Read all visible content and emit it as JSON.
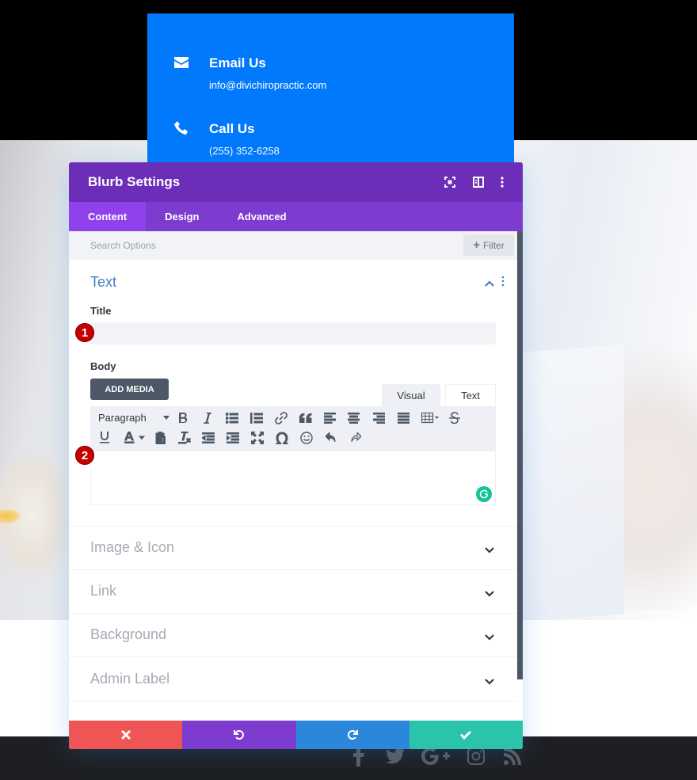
{
  "contact_card": {
    "items": [
      {
        "icon": "envelope-icon",
        "title": "Email Us",
        "text": "info@divichiropractic.com"
      },
      {
        "icon": "phone-icon",
        "title": "Call Us",
        "text": "(255) 352-6258"
      }
    ]
  },
  "modal": {
    "title": "Blurb Settings",
    "header_icons": [
      "fullscreen-icon",
      "split-view-icon",
      "more-options-icon"
    ],
    "tabs": [
      {
        "label": "Content",
        "active": true
      },
      {
        "label": "Design",
        "active": false
      },
      {
        "label": "Advanced",
        "active": false
      }
    ],
    "search": {
      "placeholder": "Search Options",
      "value": ""
    },
    "filter_label": "Filter",
    "text_section": {
      "title": "Text",
      "expanded": true,
      "title_field": {
        "label": "Title",
        "value": ""
      },
      "body_field": {
        "label": "Body",
        "add_media_label": "ADD MEDIA",
        "editor_tabs": [
          {
            "label": "Visual",
            "active": true
          },
          {
            "label": "Text",
            "active": false
          }
        ],
        "format_select": "Paragraph",
        "toolbar_row1": [
          "bold",
          "italic",
          "bullet-list",
          "numbered-list",
          "link",
          "blockquote",
          "align-left",
          "align-center",
          "align-right",
          "align-justify",
          "table",
          "strikethrough"
        ],
        "toolbar_row2": [
          "underline",
          "text-color",
          "paste-as-text",
          "clear-formatting",
          "outdent",
          "indent",
          "fullscreen",
          "special-character",
          "emoji",
          "undo",
          "redo"
        ],
        "value": ""
      }
    },
    "collapsed_sections": [
      "Image & Icon",
      "Link",
      "Background",
      "Admin Label"
    ],
    "footer_buttons": [
      {
        "name": "cancel",
        "color": "#ef5555"
      },
      {
        "name": "undo",
        "color": "#7e3bd0"
      },
      {
        "name": "redo",
        "color": "#2b87da"
      },
      {
        "name": "save",
        "color": "#29c4a9"
      }
    ]
  },
  "annotations": {
    "badge_1": "1",
    "badge_2": "2"
  },
  "footer_social": [
    "facebook",
    "twitter",
    "google-plus",
    "instagram",
    "rss"
  ],
  "colors": {
    "contact_blue": "#0079fc",
    "modal_header": "#6c2eb9",
    "tabs_bg": "#7d3bcf",
    "tab_active": "#8f42ec",
    "section_title": "#3e7fbf"
  }
}
